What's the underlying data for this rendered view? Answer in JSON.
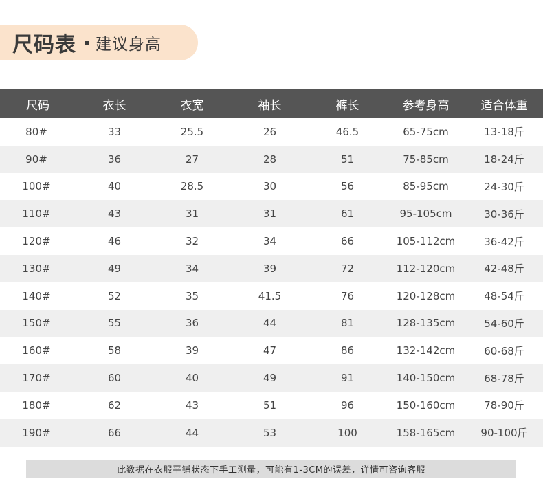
{
  "title": {
    "main": "尺码表",
    "sub": "建议身高"
  },
  "table": {
    "headers": [
      "尺码",
      "衣长",
      "衣宽",
      "袖长",
      "裤长",
      "参考身高",
      "适合体重"
    ],
    "rows": [
      [
        "80#",
        "33",
        "25.5",
        "26",
        "46.5",
        "65-75cm",
        "13-18斤"
      ],
      [
        "90#",
        "36",
        "27",
        "28",
        "51",
        "75-85cm",
        "18-24斤"
      ],
      [
        "100#",
        "40",
        "28.5",
        "30",
        "56",
        "85-95cm",
        "24-30斤"
      ],
      [
        "110#",
        "43",
        "31",
        "31",
        "61",
        "95-105cm",
        "30-36斤"
      ],
      [
        "120#",
        "46",
        "32",
        "34",
        "66",
        "105-112cm",
        "36-42斤"
      ],
      [
        "130#",
        "49",
        "34",
        "39",
        "72",
        "112-120cm",
        "42-48斤"
      ],
      [
        "140#",
        "52",
        "35",
        "41.5",
        "76",
        "120-128cm",
        "48-54斤"
      ],
      [
        "150#",
        "55",
        "36",
        "44",
        "81",
        "128-135cm",
        "54-60斤"
      ],
      [
        "160#",
        "58",
        "39",
        "47",
        "86",
        "132-142cm",
        "60-68斤"
      ],
      [
        "170#",
        "60",
        "40",
        "49",
        "91",
        "140-150cm",
        "68-78斤"
      ],
      [
        "180#",
        "62",
        "43",
        "51",
        "96",
        "150-160cm",
        "78-90斤"
      ],
      [
        "190#",
        "66",
        "44",
        "53",
        "100",
        "158-165cm",
        "90-100斤"
      ]
    ]
  },
  "note": "此数据在衣服平铺状态下手工测量，可能有1-3CM的误差，详情可咨询客服",
  "colors": {
    "title_bg": "#fbe3cc",
    "header_bg": "#555555",
    "stripe_bg": "#efefef",
    "note_bg": "#dcdcdc"
  }
}
